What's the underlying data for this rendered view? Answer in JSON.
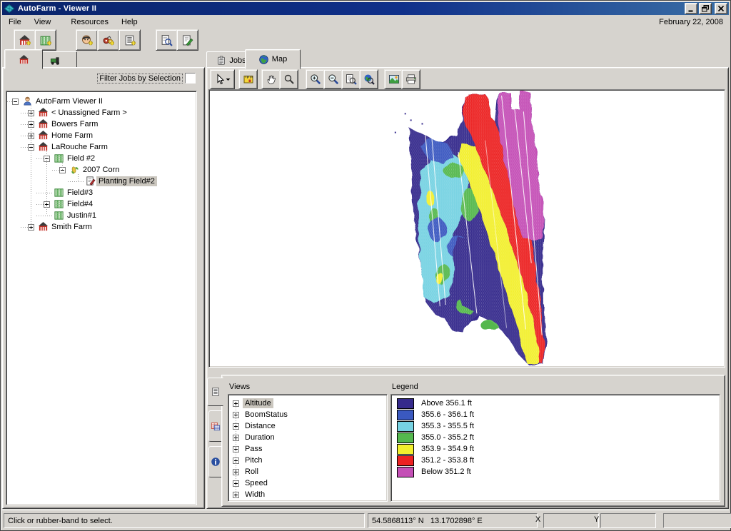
{
  "window": {
    "title": "AutoFarm - Viewer II",
    "app_icon": "autofarm-leaf-icon"
  },
  "titlebar_buttons": [
    {
      "icon": "minimize-icon"
    },
    {
      "icon": "restore-icon"
    },
    {
      "icon": "close-icon"
    }
  ],
  "menubar": {
    "items": [
      "File",
      "View",
      "Resources",
      "Help"
    ],
    "date": "February 22, 2008"
  },
  "main_toolbar": [
    {
      "id": "add-farm",
      "icon": "barn-add-icon",
      "group": 0
    },
    {
      "id": "add-field",
      "icon": "field-add-icon",
      "group": 0
    },
    {
      "id": "add-operator",
      "icon": "person-add-icon",
      "group": 1
    },
    {
      "id": "add-equipment",
      "icon": "equipment-add-icon",
      "group": 1
    },
    {
      "id": "add-crop",
      "icon": "crop-add-icon",
      "group": 1
    },
    {
      "id": "find-job",
      "icon": "document-magnifier-icon",
      "group": 2
    },
    {
      "id": "edit-report",
      "icon": "document-edit-icon",
      "group": 2
    }
  ],
  "left_panel": {
    "tabs": [
      {
        "id": "farms-tab",
        "icon": "barn-icon",
        "active": true
      },
      {
        "id": "machines-tab",
        "icon": "machine-icon",
        "active": false
      }
    ],
    "filter_label": "Filter Jobs by Selection",
    "tree": [
      {
        "label": "AutoFarm Viewer II",
        "level": 0,
        "expander": "minus",
        "icon": "user"
      },
      {
        "label": "< Unassigned Farm >",
        "level": 1,
        "expander": "plus",
        "icon": "barn"
      },
      {
        "label": "Bowers Farm",
        "level": 1,
        "expander": "plus",
        "icon": "barn"
      },
      {
        "label": "Home Farm",
        "level": 1,
        "expander": "plus",
        "icon": "barn"
      },
      {
        "label": "LaRouche Farm",
        "level": 1,
        "expander": "minus",
        "icon": "barn"
      },
      {
        "label": "Field #2",
        "level": 2,
        "expander": "minus",
        "icon": "field"
      },
      {
        "label": "2007 Corn",
        "level": 3,
        "expander": "minus",
        "icon": "corn"
      },
      {
        "label": "Planting Field#2",
        "level": 4,
        "expander": "none",
        "icon": "job",
        "selected": true
      },
      {
        "label": "Field#3",
        "level": 2,
        "expander": "none",
        "icon": "field"
      },
      {
        "label": "Field#4",
        "level": 2,
        "expander": "plus",
        "icon": "field"
      },
      {
        "label": "Justin#1",
        "level": 2,
        "expander": "none",
        "icon": "field"
      },
      {
        "label": "Smith Farm",
        "level": 1,
        "expander": "plus",
        "icon": "barn"
      }
    ]
  },
  "right_panel": {
    "tabs": [
      {
        "label": "Jobs",
        "icon": "clipboard-icon",
        "active": false
      },
      {
        "label": "Map",
        "icon": "globe-icon",
        "active": true
      }
    ],
    "map_toolbar": [
      {
        "id": "select-tool",
        "icon": "arrow-cursor-icon",
        "dropdown": true,
        "group": 0
      },
      {
        "id": "measure-tool",
        "icon": "ruler-icon",
        "group": 1
      },
      {
        "id": "pan-tool",
        "icon": "hand-icon",
        "group": 2
      },
      {
        "id": "zoom-tool",
        "icon": "magnifier-icon",
        "group": 2
      },
      {
        "id": "zoom-in",
        "icon": "zoom-in-icon",
        "group": 3
      },
      {
        "id": "zoom-out",
        "icon": "zoom-out-icon",
        "group": 3
      },
      {
        "id": "zoom-extent",
        "icon": "zoom-page-icon",
        "group": 3
      },
      {
        "id": "zoom-world",
        "icon": "zoom-globe-icon",
        "group": 3
      },
      {
        "id": "export-image",
        "icon": "image-icon",
        "group": 4
      },
      {
        "id": "print-map",
        "icon": "printer-icon",
        "group": 4
      }
    ],
    "bottom": {
      "side_tabs": [
        {
          "id": "views-tab",
          "icon": "list-icon",
          "active": true
        },
        {
          "id": "layers-tab",
          "icon": "field-overlay-icon",
          "active": false
        },
        {
          "id": "info-tab",
          "icon": "info-icon",
          "active": false
        }
      ],
      "views": {
        "label": "Views",
        "selected": "Altitude",
        "items": [
          "Altitude",
          "BoomStatus",
          "Distance",
          "Duration",
          "Pass",
          "Pitch",
          "Roll",
          "Speed",
          "Width"
        ]
      },
      "legend": {
        "label": "Legend",
        "items": [
          {
            "range": "Above 356.1 ft",
            "color": "#352a8c"
          },
          {
            "range": "355.6 - 356.1 ft",
            "color": "#3a59c0"
          },
          {
            "range": "355.3 - 355.5 ft",
            "color": "#76d2e2"
          },
          {
            "range": "355.0 - 355.2 ft",
            "color": "#54b84e"
          },
          {
            "range": "353.9 - 354.9 ft",
            "color": "#f2ef2e"
          },
          {
            "range": "351.2 - 353.8 ft",
            "color": "#ec2123"
          },
          {
            "range": "Below 351.2 ft",
            "color": "#c44fb6"
          }
        ]
      }
    }
  },
  "map": {
    "view": "Altitude",
    "band_to_legend_index": {
      "indigo": 0,
      "blue": 1,
      "cyan": 2,
      "green": 3,
      "yellow": 4,
      "red": 5,
      "magenta": 6
    }
  },
  "statusbar": {
    "message": "Click or rubber-band to select.",
    "coordinates": "54.5868113° N   13.1702898° E",
    "x_label": "X",
    "y_label": "Y"
  }
}
